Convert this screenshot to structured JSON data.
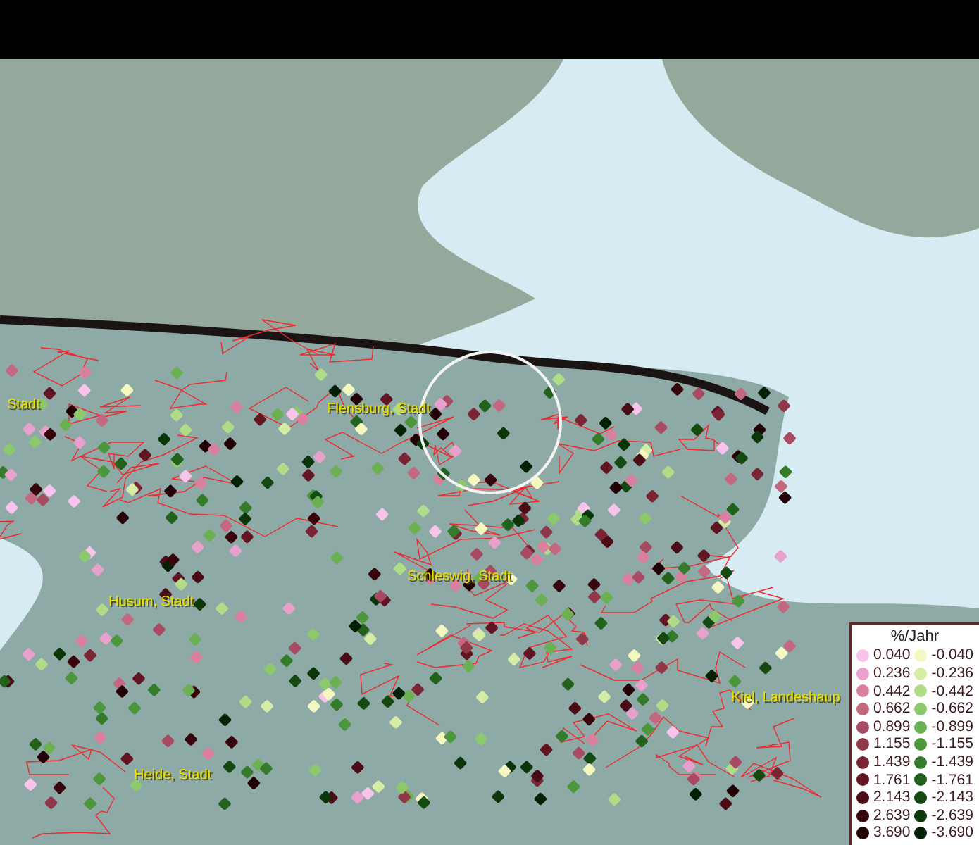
{
  "map": {
    "place_labels": [
      "Stadt",
      "Flensburg, Stadt",
      "Schleswig, Stadt",
      "Husum, Stadt",
      "Kiel, Landeshaup",
      "Heide, Stadt"
    ]
  },
  "legend": {
    "title": "%/Jahr",
    "positive": [
      {
        "label": "0.040",
        "color": "#f8c4ec"
      },
      {
        "label": "0.236",
        "color": "#e8a0cc"
      },
      {
        "label": "0.442",
        "color": "#d8809e"
      },
      {
        "label": "0.662",
        "color": "#c46882"
      },
      {
        "label": "0.899",
        "color": "#a84a62"
      },
      {
        "label": "1.155",
        "color": "#903848"
      },
      {
        "label": "1.439",
        "color": "#7a2434"
      },
      {
        "label": "1.761",
        "color": "#621624"
      },
      {
        "label": "2.143",
        "color": "#4a0c16"
      },
      {
        "label": "2.639",
        "color": "#36060c"
      },
      {
        "label": "3.690",
        "color": "#220206"
      }
    ],
    "negative": [
      {
        "label": "-0.040",
        "color": "#f4f8c0"
      },
      {
        "label": "-0.236",
        "color": "#d4eca4"
      },
      {
        "label": "-0.442",
        "color": "#b0dc88"
      },
      {
        "label": "-0.662",
        "color": "#8cc86c"
      },
      {
        "label": "-0.899",
        "color": "#6cb054"
      },
      {
        "label": "-1.155",
        "color": "#4c963c"
      },
      {
        "label": "-1.439",
        "color": "#347c2c"
      },
      {
        "label": "-1.761",
        "color": "#22621c"
      },
      {
        "label": "-2.143",
        "color": "#144a12"
      },
      {
        "label": "-2.639",
        "color": "#0a360a"
      },
      {
        "label": "-3.690",
        "color": "#042004"
      }
    ]
  }
}
